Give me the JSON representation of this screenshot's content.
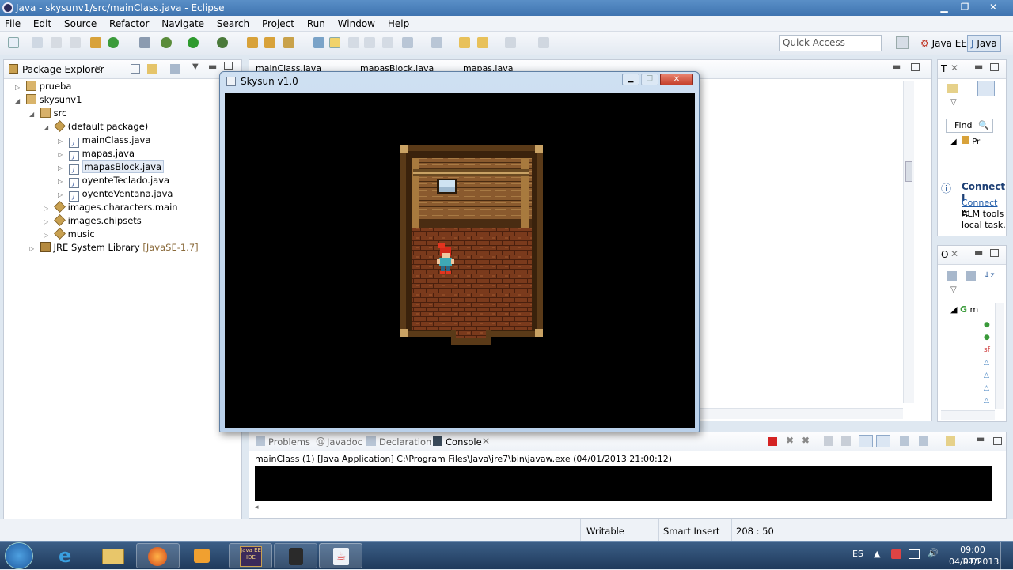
{
  "window": {
    "title": "Java - skysunv1/src/mainClass.java - Eclipse"
  },
  "menu": [
    "File",
    "Edit",
    "Source",
    "Refactor",
    "Navigate",
    "Search",
    "Project",
    "Run",
    "Window",
    "Help"
  ],
  "toolbar": {
    "quick_access_placeholder": "Quick Access",
    "perspective_javaee": "Java EE",
    "perspective_java": "Java"
  },
  "package_explorer": {
    "title": "Package Explorer",
    "items": [
      {
        "label": "prueba"
      },
      {
        "label": "skysunv1"
      },
      {
        "label": "src"
      },
      {
        "label": "(default package)"
      },
      {
        "label": "mainClass.java"
      },
      {
        "label": "mapas.java"
      },
      {
        "label": "mapasBlock.java"
      },
      {
        "label": "oyenteTeclado.java"
      },
      {
        "label": "oyenteVentana.java"
      },
      {
        "label": "images.characters.main"
      },
      {
        "label": "images.chipsets"
      },
      {
        "label": "music"
      },
      {
        "label": "JRE System Library",
        "suffix": "[JavaSE-1.7]"
      }
    ]
  },
  "editor_tabs": [
    "mainClass.java",
    "mapasBlock.java",
    "mapas.java"
  ],
  "skysun": {
    "title": "Skysun v1.0"
  },
  "task_panel": {
    "tab": "T",
    "find": "Find",
    "all": "Pr",
    "connect_title": "Connect I",
    "connect_link": "Connect",
    "connect_text1": " tc",
    "connect_text2": "ALM tools",
    "connect_text3": "local task."
  },
  "outline_panel": {
    "tab": "O",
    "item": "m"
  },
  "bottom_tabs": [
    "Problems",
    "Javadoc",
    "Declaration",
    "Console"
  ],
  "console": {
    "header": "mainClass (1) [Java Application] C:\\Program Files\\Java\\jre7\\bin\\javaw.exe (04/01/2013 21:00:12)"
  },
  "status": {
    "writable": "Writable",
    "insert_mode": "Smart Insert",
    "position": "208 : 50"
  },
  "taskbar": {
    "lang": "ES",
    "time": "09:00 p.m.",
    "date": "04/01/2013",
    "eclipse_icon_label": "Java EE IDE"
  }
}
